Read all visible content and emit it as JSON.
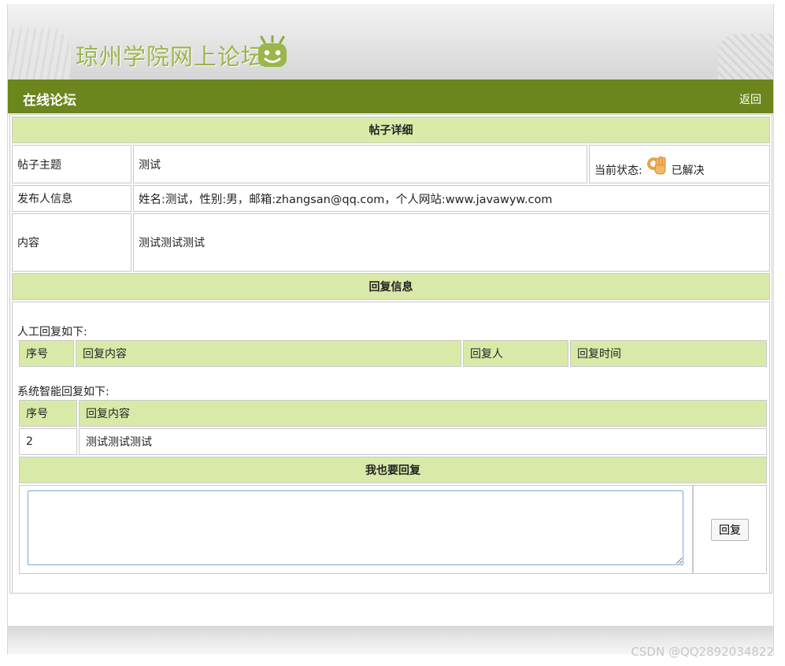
{
  "header": {
    "site_title": "琼州学院网上论坛"
  },
  "navbar": {
    "title": "在线论坛",
    "back_label": "返回"
  },
  "post_detail": {
    "section_title": "帖子详细",
    "subject_label": "帖子主题",
    "subject_value": "测试",
    "status_label": "当前状态:",
    "status_value": "已解决",
    "status_icon": "ok-hand-icon",
    "poster_label": "发布人信息",
    "poster_value": "姓名:测试，性别:男，邮箱:zhangsan@qq.com，个人网站:www.javawyw.com",
    "content_label": "内容",
    "content_value": "测试测试测试"
  },
  "reply_info": {
    "section_title": "回复信息",
    "manual_label": "人工回复如下:",
    "manual_columns": [
      "序号",
      "回复内容",
      "回复人",
      "回复时间"
    ],
    "system_label": "系统智能回复如下:",
    "system_columns": [
      "序号",
      "回复内容"
    ],
    "system_rows": [
      {
        "no": "2",
        "content": "测试测试测试"
      }
    ]
  },
  "reply_form": {
    "title": "我也要回复",
    "textarea_value": "",
    "button_label": "回复"
  },
  "watermark": "CSDN @QQ2892034822",
  "colors": {
    "green_bar": "#6b861c",
    "header_fill": "#d9eaa8",
    "title_green": "#9bb64a"
  }
}
